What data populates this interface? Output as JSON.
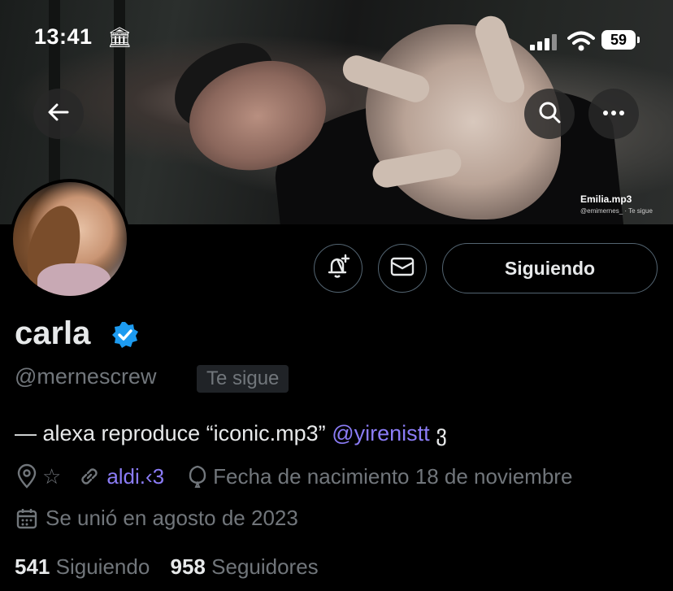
{
  "status_bar": {
    "time": "13:41",
    "bank_glyph": "🏛",
    "battery": "59"
  },
  "banner": {
    "watermark_name": "Emilia.mp3",
    "watermark_sub": "@emimernes_ · Te sigue"
  },
  "profile": {
    "name": "carla",
    "handle": "@mernescrew",
    "follows_you_badge": "Te sigue",
    "follow_button_label": "Siguiendo",
    "bio_text": "— alexa reproduce “iconic.mp3”",
    "bio_mention": "@yirenistt",
    "bio_suffix": "ვ",
    "location": "☆",
    "website": "aldi.‹3",
    "birthday": "Fecha de nacimiento 18 de noviembre",
    "joined": "Se unió en agosto de 2023",
    "following_count": "541",
    "following_label": "Siguiendo",
    "followers_count": "958",
    "followers_label": "Seguidores"
  },
  "colors": {
    "background": "#000000",
    "text": "#e7e9ea",
    "muted": "#71767b",
    "link": "#8b7cf6",
    "verified": "#1d9bf0"
  },
  "icons": [
    "back-arrow-icon",
    "search-icon",
    "more-icon",
    "notification-bell-icon",
    "mail-icon",
    "location-icon",
    "link-icon",
    "birthday-icon",
    "calendar-icon",
    "verified-badge-icon"
  ]
}
